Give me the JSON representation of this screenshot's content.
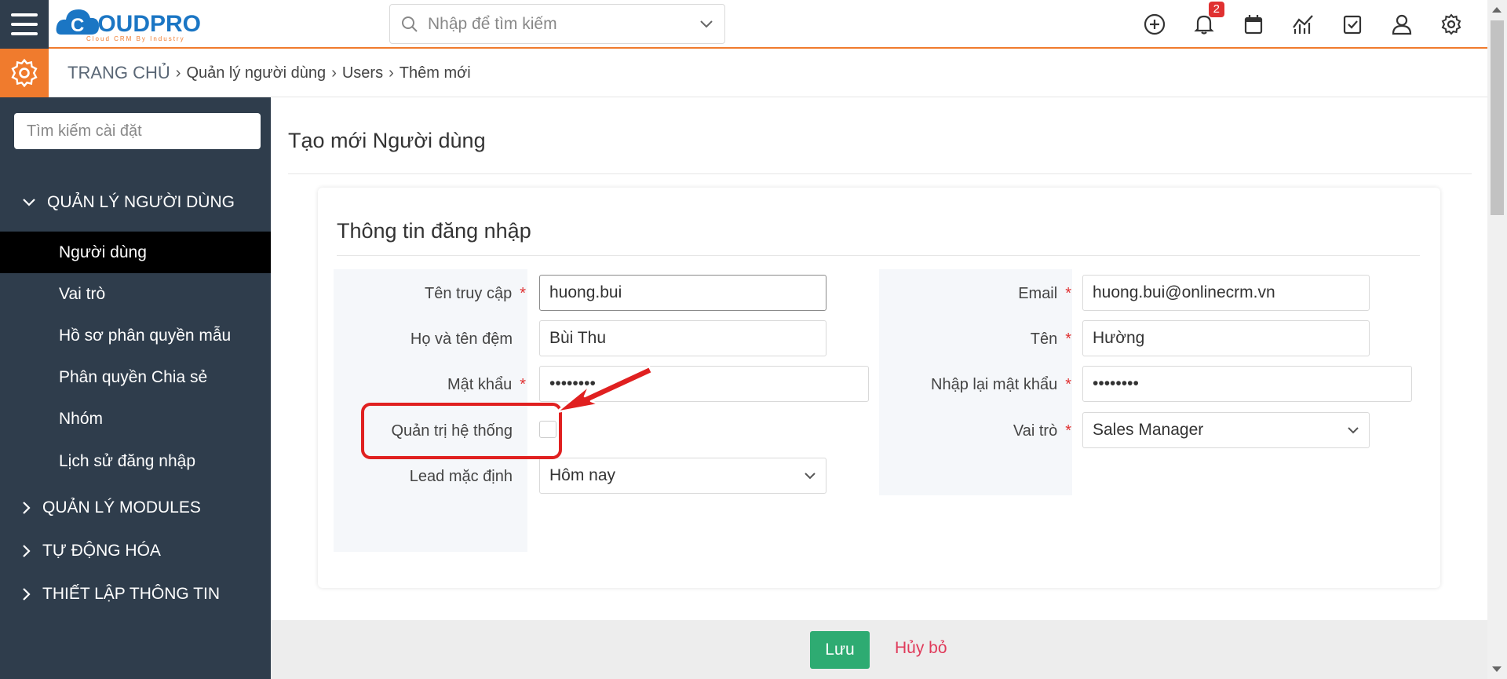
{
  "app": {
    "logo_text": "CLOUDPRO",
    "logo_tagline": "Cloud CRM By Industry"
  },
  "topbar": {
    "search_placeholder": "Nhập để tìm kiếm",
    "notification_count": "2",
    "icons": [
      "plus-circle-icon",
      "bell-icon",
      "calendar-icon",
      "chart-icon",
      "task-check-icon",
      "user-icon",
      "gear-icon"
    ]
  },
  "breadcrumb": {
    "home": "TRANG CHỦ",
    "items": [
      "Quản lý người dùng",
      "Users",
      "Thêm mới"
    ]
  },
  "sidebar": {
    "search_placeholder": "Tìm kiếm cài đặt",
    "sections": [
      {
        "label": "QUẢN LÝ NGƯỜI DÙNG",
        "expanded": true
      },
      {
        "label": "QUẢN LÝ MODULES",
        "expanded": false
      },
      {
        "label": "TỰ ĐỘNG HÓA",
        "expanded": false
      },
      {
        "label": "THIẾT LẬP THÔNG TIN",
        "expanded": false
      }
    ],
    "items": [
      "Người dùng",
      "Vai trò",
      "Hồ sơ phân quyền mẫu",
      "Phân quyền Chia sẻ",
      "Nhóm",
      "Lịch sử đăng nhập"
    ],
    "active_item": "Người dùng"
  },
  "main": {
    "page_title": "Tạo mới Người dùng",
    "section_title": "Thông tin đăng nhập",
    "fields": {
      "username": {
        "label": "Tên truy cập",
        "value": "huong.bui"
      },
      "email": {
        "label": "Email",
        "value": "huong.bui@onlinecrm.vn"
      },
      "last_name": {
        "label": "Họ và tên đệm",
        "value": "Bùi Thu"
      },
      "first_name": {
        "label": "Tên",
        "value": "Hường"
      },
      "password": {
        "label": "Mật khẩu",
        "value": "••••••••"
      },
      "confirm_password": {
        "label": "Nhập lại mật khẩu",
        "value": "••••••••"
      },
      "is_admin": {
        "label": "Quản trị hệ thống",
        "checked": false
      },
      "role": {
        "label": "Vai trò",
        "value": "Sales Manager"
      },
      "default_lead": {
        "label": "Lead mặc định",
        "value": "Hôm nay"
      }
    },
    "required_mark": "*"
  },
  "footer": {
    "save_label": "Lưu",
    "cancel_label": "Hủy bỏ"
  },
  "colors": {
    "accent": "#f07b2d",
    "sidebar_bg": "#2f3d4c",
    "save_green": "#2eab72",
    "cancel_red": "#e03a5a",
    "highlight_red": "#e02020"
  }
}
